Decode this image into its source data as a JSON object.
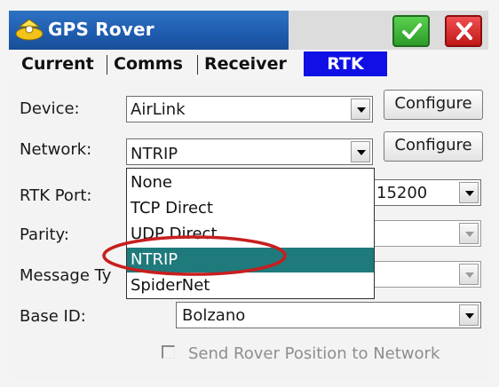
{
  "window": {
    "title": "GPS Rover",
    "ok_icon": "checkmark-icon",
    "close_icon": "close-icon"
  },
  "tabs": [
    {
      "label": "Current",
      "active": false
    },
    {
      "label": "Comms",
      "active": false
    },
    {
      "label": "Receiver",
      "active": false
    },
    {
      "label": "RTK",
      "active": true
    }
  ],
  "form": {
    "device": {
      "label": "Device:",
      "value": "AirLink",
      "button": "Configure"
    },
    "network": {
      "label": "Network:",
      "value": "NTRIP",
      "button": "Configure"
    },
    "rtk_port": {
      "label": "RTK Port:",
      "value": "15200"
    },
    "parity": {
      "label": "Parity:",
      "value": ""
    },
    "message_type": {
      "label": "Message Ty",
      "value": ""
    },
    "base_id": {
      "label": "Base ID:",
      "value": "Bolzano"
    },
    "send_position": {
      "label": "Send Rover Position to Network",
      "checked": false
    }
  },
  "network_dropdown": {
    "options": [
      "None",
      "TCP Direct",
      "UDP Direct",
      "NTRIP",
      "SpiderNet"
    ],
    "selected": "NTRIP"
  },
  "colors": {
    "title_bar": "#1f5db0",
    "active_tab": "#1010e6",
    "selection": "#1f7a7c",
    "annotation_ring": "#c81e1e"
  }
}
